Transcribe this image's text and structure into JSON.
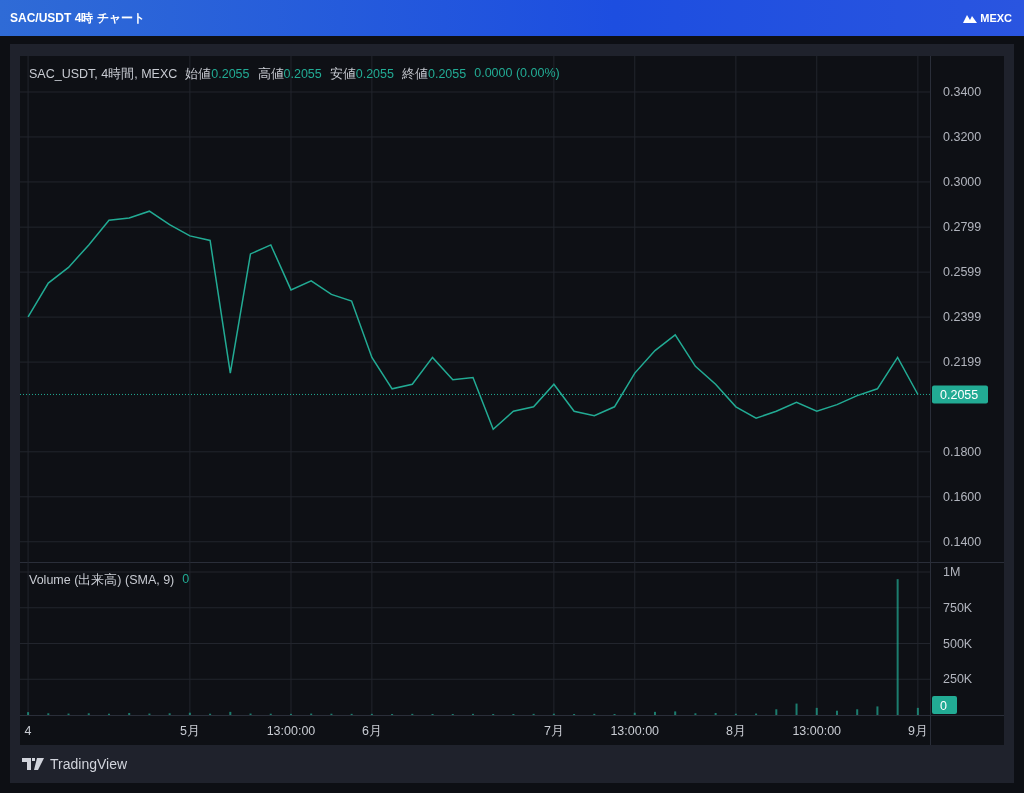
{
  "header": {
    "title": "SAC/USDT 4時 チャート",
    "brand": "MEXC"
  },
  "legend": {
    "symbol": "SAC_USDT, 4時間, MEXC",
    "fields": [
      {
        "label": "始値",
        "value": "0.2055"
      },
      {
        "label": "高値",
        "value": "0.2055"
      },
      {
        "label": "安値",
        "value": "0.2055"
      },
      {
        "label": "終値",
        "value": "0.2055"
      }
    ],
    "change": "0.0000 (0.00%)"
  },
  "price_chart": {
    "chart_data": {
      "type": "line",
      "grid": true,
      "ylim": [
        0.131,
        0.356
      ],
      "series": [
        {
          "color": "#22ab94",
          "values": [
            0.24,
            0.255,
            0.262,
            0.272,
            0.283,
            0.284,
            0.287,
            0.281,
            0.276,
            0.274,
            0.215,
            0.268,
            0.272,
            0.252,
            0.256,
            0.25,
            0.247,
            0.222,
            0.208,
            0.21,
            0.222,
            0.212,
            0.213,
            0.19,
            0.198,
            0.2,
            0.21,
            0.198,
            0.196,
            0.2,
            0.215,
            0.225,
            0.232,
            0.218,
            0.21,
            0.2,
            0.195,
            0.198,
            0.202,
            0.198,
            0.201,
            0.205,
            0.208,
            0.222,
            0.2055
          ]
        }
      ],
      "ref_lines": [
        {
          "axis": "y",
          "value": 0.2055,
          "label": "0.2055",
          "color": "#22ab94"
        }
      ],
      "yticks": [
        {
          "value": 0.34,
          "label": "0.3400"
        },
        {
          "value": 0.32,
          "label": "0.3200"
        },
        {
          "value": 0.3,
          "label": "0.3000"
        },
        {
          "value": 0.2799,
          "label": "0.2799"
        },
        {
          "value": 0.2599,
          "label": "0.2599"
        },
        {
          "value": 0.2399,
          "label": "0.2399"
        },
        {
          "value": 0.2199,
          "label": "0.2199"
        },
        {
          "value": 0.18,
          "label": "0.1800"
        },
        {
          "value": 0.16,
          "label": "0.1600"
        },
        {
          "value": 0.14,
          "label": "0.1400"
        }
      ]
    }
  },
  "volume_chart": {
    "title": "Volume (出来高) (SMA, 9)",
    "value": "0",
    "last_volume_label": "0",
    "chart_data": {
      "type": "bar",
      "grid": true,
      "categories": [
        "4",
        null,
        null,
        null,
        null,
        null,
        null,
        null,
        "5月",
        null,
        null,
        null,
        null,
        "13:00:00",
        null,
        null,
        null,
        "6月",
        null,
        null,
        null,
        null,
        null,
        null,
        null,
        null,
        "7月",
        null,
        null,
        null,
        "13:00:00",
        null,
        null,
        null,
        null,
        "8月",
        null,
        null,
        null,
        "13:00:00",
        null,
        null,
        null,
        null,
        "9月"
      ],
      "ylim": [
        0,
        1070000
      ],
      "series": [
        {
          "color": "#22ab94",
          "values": [
            20000,
            12000,
            10000,
            12000,
            9000,
            14000,
            10000,
            12000,
            16000,
            9000,
            22000,
            10000,
            9000,
            8000,
            10000,
            9000,
            8000,
            8000,
            7000,
            8000,
            7000,
            7000,
            8000,
            7000,
            7000,
            8000,
            9000,
            7000,
            8000,
            7000,
            16000,
            22000,
            25000,
            12000,
            14000,
            9000,
            10000,
            40000,
            80000,
            50000,
            30000,
            40000,
            60000,
            950000,
            50000
          ]
        }
      ],
      "yticks": [
        {
          "value": 1000000,
          "label": "1M"
        },
        {
          "value": 750000,
          "label": "750K"
        },
        {
          "value": 500000,
          "label": "500K"
        },
        {
          "value": 250000,
          "label": "250K"
        }
      ]
    }
  },
  "footer": {
    "brand": "TradingView"
  }
}
